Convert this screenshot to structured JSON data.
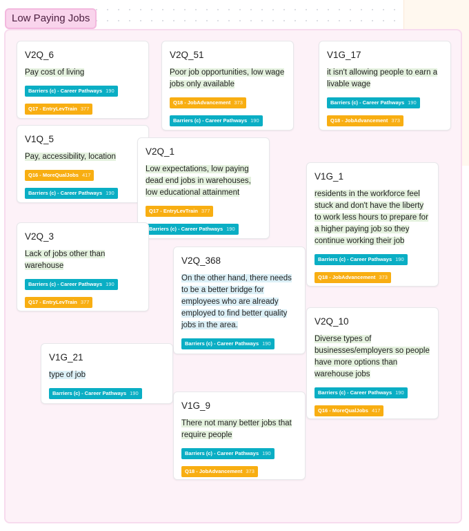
{
  "frame": {
    "title": "Low Paying Jobs"
  },
  "colors": {
    "teal": "#0aaec4",
    "orange": "#f8ae12",
    "highlight_green": "#e4f1de",
    "highlight_blue": "#dcf0f7",
    "frame_bg": "#fdf2f8"
  },
  "cards": [
    {
      "id": "V2Q_6",
      "text": "Pay cost of living",
      "tags": [
        {
          "label": "Barriers (c) - Career Pathways",
          "count": "190"
        },
        {
          "label": "Q17 - EntryLevTrain",
          "count": "377"
        }
      ]
    },
    {
      "id": "V2Q_51",
      "text": "Poor job opportunities, low wage jobs only available",
      "tags": [
        {
          "label": "Q18 - JobAdvancement",
          "count": "373"
        },
        {
          "label": "Barriers (c) - Career Pathways",
          "count": "190"
        }
      ]
    },
    {
      "id": "V1G_17",
      "text": "it isn't allowing people to earn a livable wage",
      "tags": [
        {
          "label": "Barriers (c) - Career Pathways",
          "count": "190"
        },
        {
          "label": "Q18 - JobAdvancement",
          "count": "373"
        }
      ]
    },
    {
      "id": "V1Q_5",
      "text": "Pay, accessibility, location",
      "tags": [
        {
          "label": "Q16 - MoreQualJobs",
          "count": "417"
        },
        {
          "label": "Barriers (c) - Career Pathways",
          "count": "190"
        }
      ]
    },
    {
      "id": "V2Q_1",
      "text": "Low expectations, low paying dead end jobs in warehouses, low educational attainment",
      "tags": [
        {
          "label": "Q17 - EntryLevTrain",
          "count": "377"
        },
        {
          "label": "Barriers (c) - Career Pathways",
          "count": "190"
        }
      ]
    },
    {
      "id": "V1G_1",
      "text": "residents in the workforce feel stuck and don't have the liberty to work less hours to prepare for a higher paying job so they continue working their job",
      "tags": [
        {
          "label": "Barriers (c) - Career Pathways",
          "count": "190"
        },
        {
          "label": "Q18 - JobAdvancement",
          "count": "373"
        }
      ]
    },
    {
      "id": "V2Q_3",
      "text": "Lack of jobs other than warehouse",
      "tags": [
        {
          "label": "Barriers (c) - Career Pathways",
          "count": "190"
        },
        {
          "label": "Q17 - EntryLevTrain",
          "count": "377"
        }
      ]
    },
    {
      "id": "V2Q_368",
      "text": "On the other hand, there needs to be a better bridge for employees who are already employed to find better quality jobs in the area.",
      "tags": [
        {
          "label": "Barriers (c) - Career Pathways",
          "count": "190"
        }
      ]
    },
    {
      "id": "V2Q_10",
      "text": "Diverse types of businesses/employers so people have more options than warehouse jobs",
      "tags": [
        {
          "label": "Barriers (c) - Career Pathways",
          "count": "190"
        },
        {
          "label": "Q16 - MoreQualJobs",
          "count": "417"
        }
      ]
    },
    {
      "id": "V1G_21",
      "text": "type of job",
      "tags": [
        {
          "label": "Barriers (c) - Career Pathways",
          "count": "190"
        }
      ]
    },
    {
      "id": "V1G_9",
      "text": "There not many better jobs that require people",
      "tags": [
        {
          "label": "Barriers (c) - Career Pathways",
          "count": "190"
        },
        {
          "label": "Q18 - JobAdvancement",
          "count": "373"
        }
      ]
    }
  ]
}
